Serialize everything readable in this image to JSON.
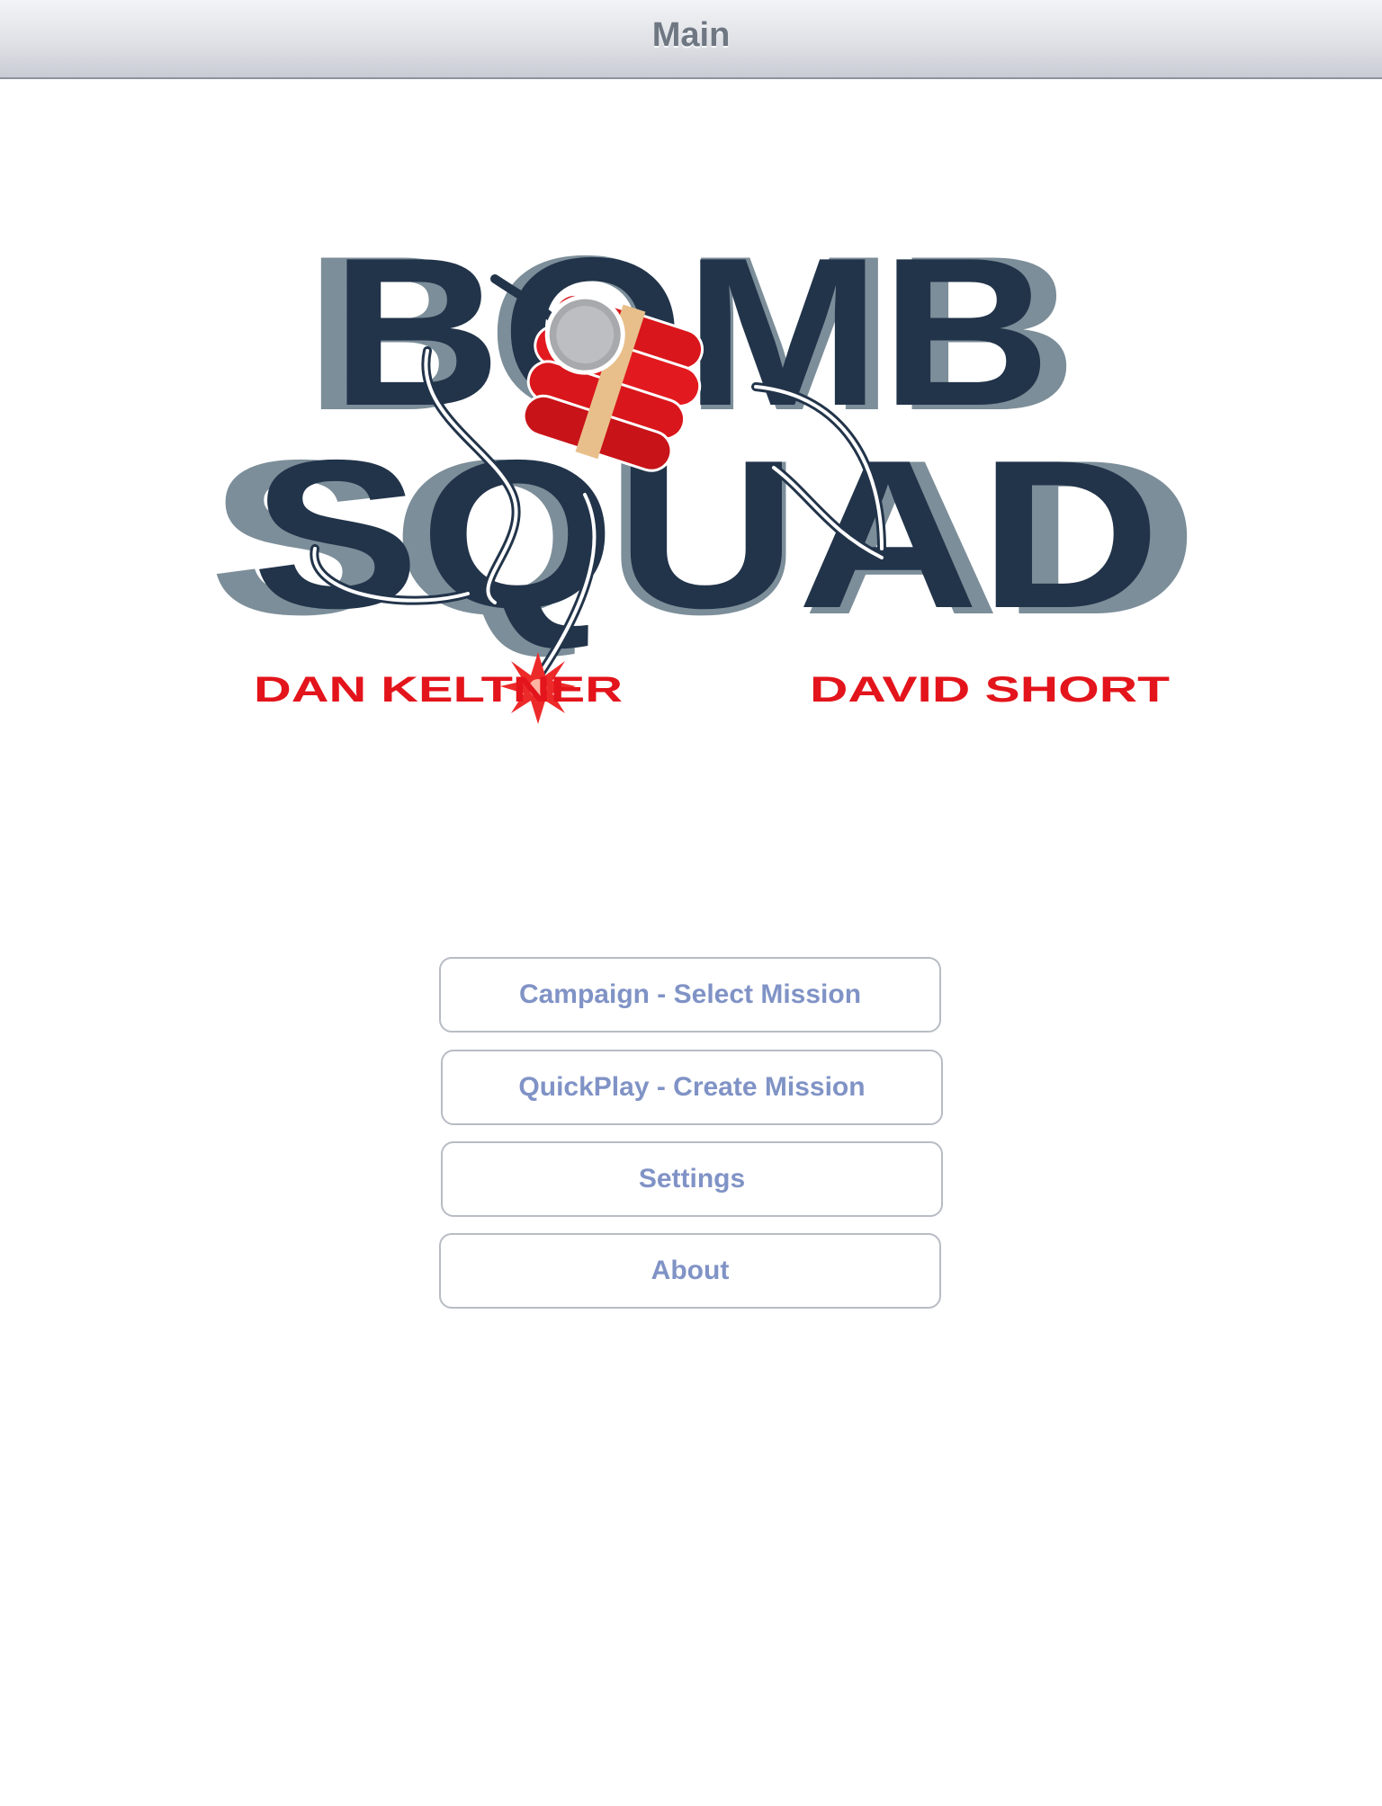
{
  "navbar": {
    "title": "Main"
  },
  "logo": {
    "title_line1": "BOMB",
    "title_line2": "SQUAD",
    "author_left": "DAN KELTNER",
    "author_right": "DAVID SHORT",
    "colors": {
      "letters_dark": "#22344a",
      "letters_shadow": "#7c8e99",
      "dynamite_red": "#d9161b",
      "tape": "#e8bf8a",
      "author_red": "#e3141b"
    }
  },
  "menu": {
    "buttons": [
      {
        "label": "Campaign - Select Mission"
      },
      {
        "label": "QuickPlay - Create Mission"
      },
      {
        "label": "Settings"
      },
      {
        "label": "About"
      }
    ]
  },
  "theme": {
    "button_text": "#8093c6",
    "button_border": "#b8bcc4",
    "title_text": "#6f7782"
  }
}
